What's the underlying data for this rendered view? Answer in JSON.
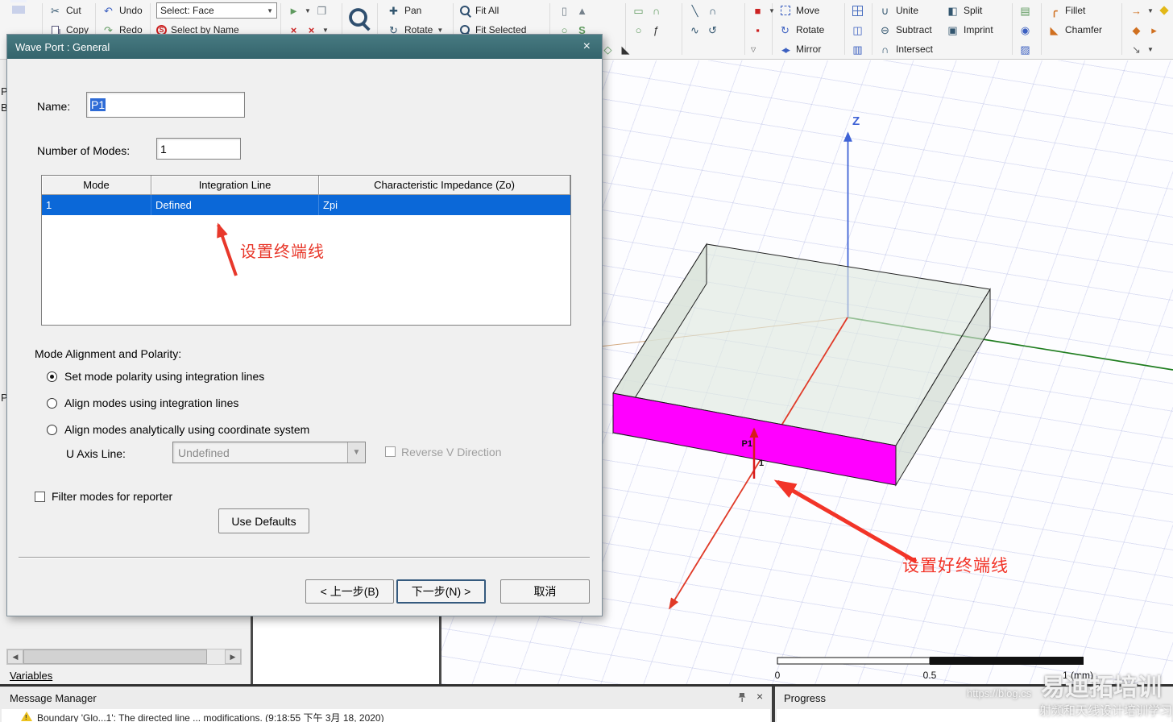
{
  "toolbar": {
    "cut": "Cut",
    "copy": "Copy",
    "undo": "Undo",
    "redo": "Redo",
    "select_mode": "Select: Face",
    "select_by_name": "Select by Name",
    "pan": "Pan",
    "rotate_view": "Rotate",
    "fit_all": "Fit All",
    "fit_selected": "Fit Selected",
    "move": "Move",
    "rotate": "Rotate",
    "mirror": "Mirror",
    "unite": "Unite",
    "subtract": "Subtract",
    "intersect": "Intersect",
    "split": "Split",
    "imprint": "Imprint",
    "fillet": "Fillet",
    "chamfer": "Chamfer"
  },
  "fragments": {
    "f1": "P",
    "f2": "B",
    "f3": "P"
  },
  "dialog": {
    "title": "Wave Port : General",
    "close": "×",
    "name_label": "Name:",
    "name_value": "P1",
    "modes_label": "Number of Modes:",
    "modes_value": "1",
    "table_headers": [
      "Mode",
      "Integration Line",
      "Characteristic Impedance (Zo)"
    ],
    "row": {
      "mode": "1",
      "integration": "Defined",
      "impedance": "Zpi"
    },
    "annotation": "设置终端线",
    "alignment_label": "Mode Alignment and Polarity:",
    "radio1": "Set mode polarity using integration lines",
    "radio2": "Align modes using integration lines",
    "radio3": "Align modes analytically using coordinate system",
    "u_axis_label": "U Axis Line:",
    "u_axis_value": "Undefined",
    "reverse_v": "Reverse V Direction",
    "filter": "Filter modes for reporter",
    "use_defaults": "Use Defaults",
    "back": "< 上一步(B)",
    "next": "下一步(N) >",
    "cancel": "取消"
  },
  "viewport": {
    "z_label": "Z",
    "port_label": "P1",
    "mode_number": "1",
    "annotation": "设置好终端线",
    "scale_0": "0",
    "scale_mid": "0.5",
    "scale_end": "1 (mm)",
    "port_color": "#ff00ff",
    "x_axis_color": "#e03a28",
    "y_axis_color": "#1f7d1f",
    "z_axis_color": "#3f63d6"
  },
  "bottom": {
    "variables": "Variables",
    "message_manager_title": "Message Manager",
    "progress_title": "Progress",
    "message": "Boundary 'Glo...1': The directed line ... modifications. (9:18:55 下午 3月 18, 2020)"
  },
  "watermark": {
    "line1": "易迪拓培训",
    "line2": "https://blog.cs",
    "line3": "射频和天线设计培训学习"
  }
}
